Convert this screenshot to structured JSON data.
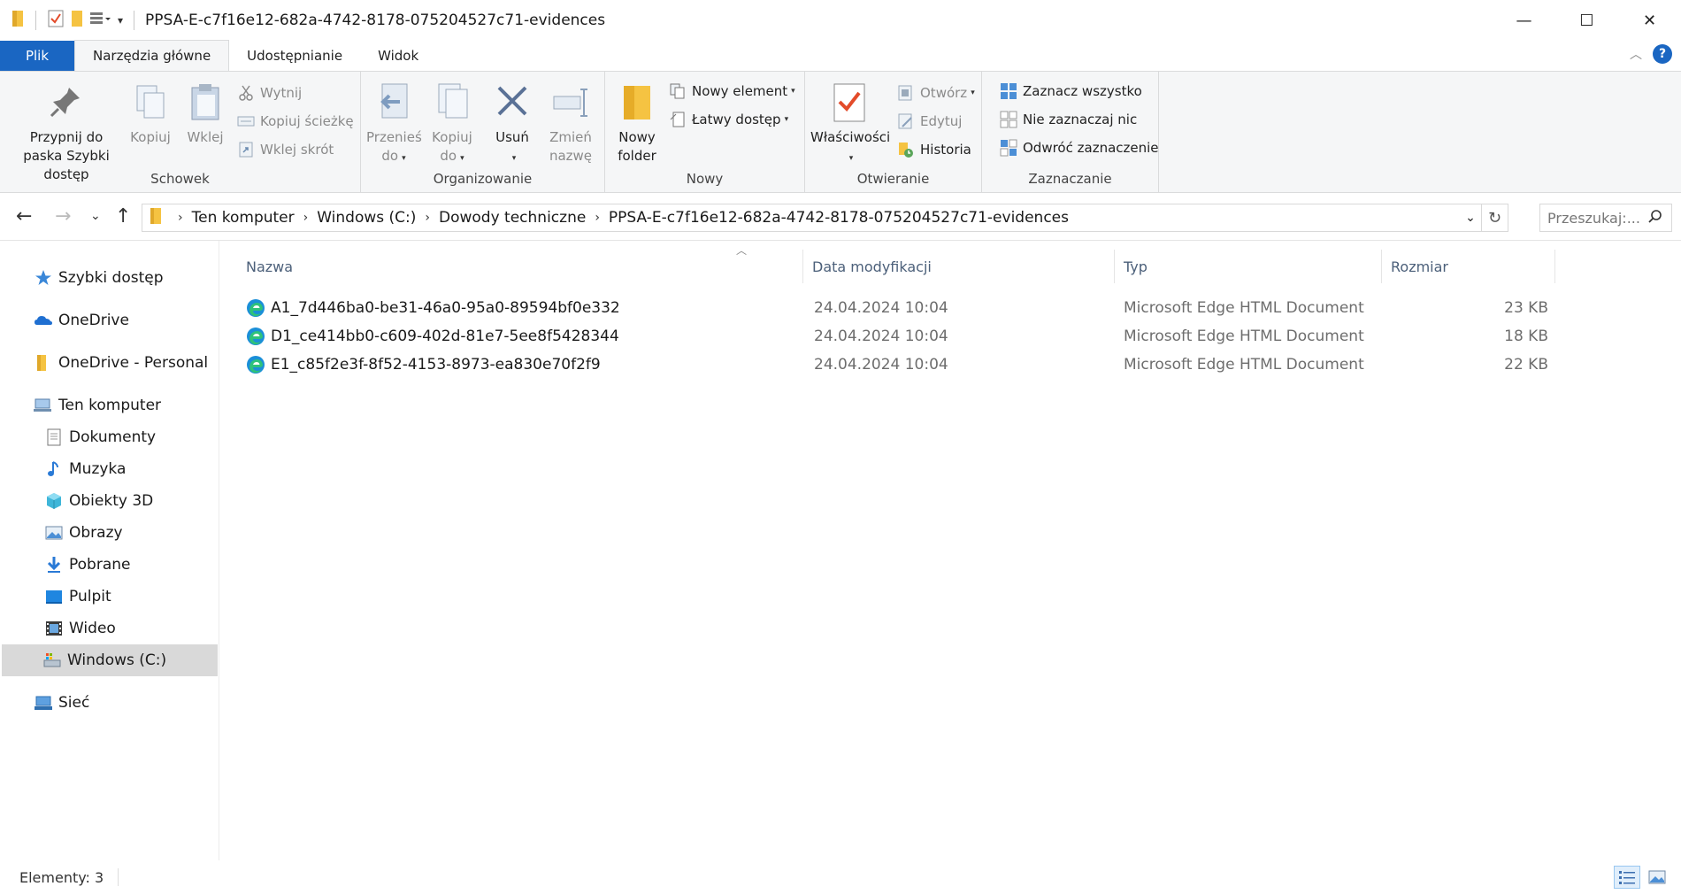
{
  "window": {
    "title": "PPSA-E-c7f16e12-682a-4742-8178-075204527c71-evidences",
    "minimize": "—",
    "maximize": "☐",
    "close": "✕"
  },
  "tabs": [
    {
      "label": "Plik"
    },
    {
      "label": "Narzędzia główne"
    },
    {
      "label": "Udostępnianie"
    },
    {
      "label": "Widok"
    }
  ],
  "ribbon": {
    "clipboard": {
      "label": "Schowek",
      "pin": "Przypnij do paska Szybki dostęp",
      "copy": "Kopiuj",
      "paste": "Wklej",
      "cut": "Wytnij",
      "copy_path": "Kopiuj ścieżkę",
      "paste_shortcut": "Wklej skrót"
    },
    "organize": {
      "label": "Organizowanie",
      "move_to": "Przenieś do",
      "copy_to": "Kopiuj do",
      "delete": "Usuń",
      "rename": "Zmień nazwę"
    },
    "new": {
      "label": "Nowy",
      "new_folder": "Nowy folder",
      "new_item": "Nowy element",
      "easy_access": "Łatwy dostęp"
    },
    "open": {
      "label": "Otwieranie",
      "properties": "Właściwości",
      "open": "Otwórz",
      "edit": "Edytuj",
      "history": "Historia"
    },
    "select": {
      "label": "Zaznaczanie",
      "select_all": "Zaznacz wszystko",
      "select_none": "Nie zaznaczaj nic",
      "invert": "Odwróć zaznaczenie"
    }
  },
  "address": {
    "crumbs": [
      "Ten komputer",
      "Windows (C:)",
      "Dowody techniczne",
      "PPSA-E-c7f16e12-682a-4742-8178-075204527c71-evidences"
    ],
    "search_placeholder": "Przeszukaj:..."
  },
  "nav": {
    "quick_access": "Szybki dostęp",
    "onedrive": "OneDrive",
    "onedrive_personal": "OneDrive - Personal",
    "this_pc": "Ten komputer",
    "documents": "Dokumenty",
    "music": "Muzyka",
    "objects3d": "Obiekty 3D",
    "pictures": "Obrazy",
    "downloads": "Pobrane",
    "desktop": "Pulpit",
    "videos": "Wideo",
    "windows_c": "Windows (C:)",
    "network": "Sieć"
  },
  "columns": {
    "name": "Nazwa",
    "modified": "Data modyfikacji",
    "type": "Typ",
    "size": "Rozmiar"
  },
  "files": [
    {
      "name": "A1_7d446ba0-be31-46a0-95a0-89594bf0e332",
      "modified": "24.04.2024 10:04",
      "type": "Microsoft Edge HTML Document",
      "size": "23 KB"
    },
    {
      "name": "D1_ce414bb0-c609-402d-81e7-5ee8f5428344",
      "modified": "24.04.2024 10:04",
      "type": "Microsoft Edge HTML Document",
      "size": "18 KB"
    },
    {
      "name": "E1_c85f2e3f-8f52-4153-8973-ea830e70f2f9",
      "modified": "24.04.2024 10:04",
      "type": "Microsoft Edge HTML Document",
      "size": "22 KB"
    }
  ],
  "status": {
    "items": "Elementy: 3"
  },
  "colors": {
    "accent": "#1a66c2",
    "folder": "#f5c342",
    "ribbon_bg": "#f5f6f7",
    "selected_nav": "#d9d9d9"
  }
}
